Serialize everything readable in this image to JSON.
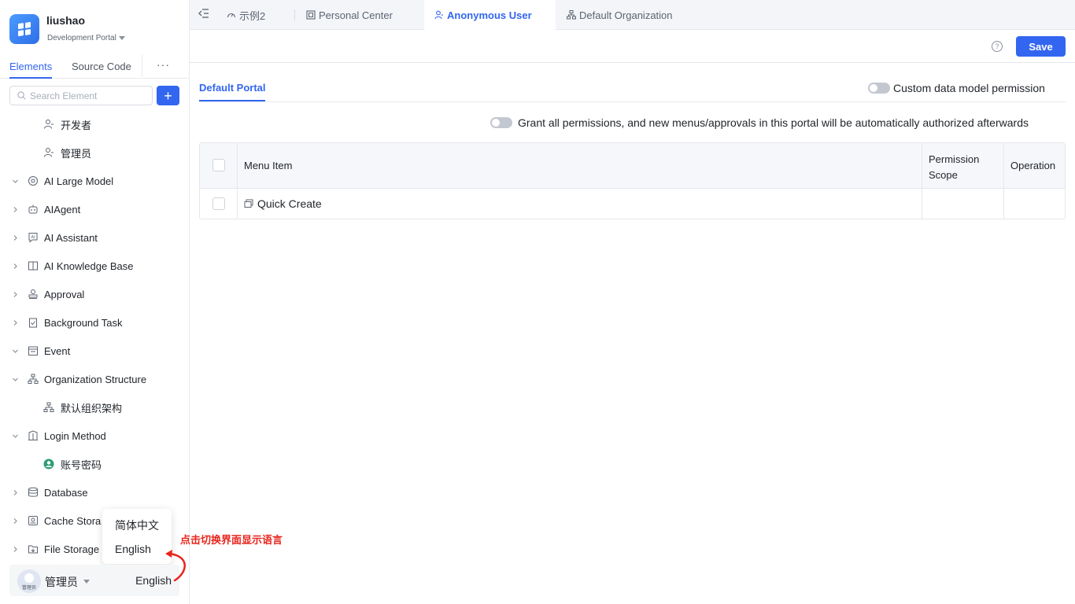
{
  "app": {
    "name": "liushao",
    "portal": "Development Portal"
  },
  "side_tabs": [
    "Elements",
    "Source Code",
    "···"
  ],
  "search": {
    "placeholder": "Search Element",
    "add_label": "+"
  },
  "tree": [
    {
      "label": "开发者",
      "icon": "role-icon",
      "expand": "none"
    },
    {
      "label": "管理员",
      "icon": "role-icon",
      "expand": "none"
    },
    {
      "label": "AI Large Model",
      "icon": "ai-model-icon",
      "expand": "open"
    },
    {
      "label": "AIAgent",
      "icon": "robot-icon",
      "expand": "closed"
    },
    {
      "label": "AI Assistant",
      "icon": "ai-assistant-icon",
      "expand": "closed"
    },
    {
      "label": "AI Knowledge Base",
      "icon": "book-icon",
      "expand": "closed"
    },
    {
      "label": "Approval",
      "icon": "stamp-icon",
      "expand": "closed"
    },
    {
      "label": "Background Task",
      "icon": "task-icon",
      "expand": "closed"
    },
    {
      "label": "Event",
      "icon": "event-icon",
      "expand": "open"
    },
    {
      "label": "Organization Structure",
      "icon": "org-icon",
      "expand": "open"
    },
    {
      "label": "默认组织架构",
      "icon": "org-icon",
      "expand": "none"
    },
    {
      "label": "Login Method",
      "icon": "login-icon",
      "expand": "open"
    },
    {
      "label": "账号密码",
      "icon": "user-circle-icon",
      "expand": "none"
    },
    {
      "label": "Database",
      "icon": "database-icon",
      "expand": "closed"
    },
    {
      "label": "Cache Stora",
      "icon": "cache-icon",
      "expand": "closed"
    },
    {
      "label": "File Storage",
      "icon": "file-storage-icon",
      "expand": "closed"
    }
  ],
  "lang_menu": {
    "options": [
      "简体中文",
      "English"
    ]
  },
  "annotation": "点击切换界面显示语言",
  "user": {
    "name": "管理员",
    "avatar_caption": "管理员",
    "language": "English"
  },
  "page_tabs": [
    {
      "label": "示例2",
      "icon": "dashboard-icon"
    },
    {
      "label": "Personal Center",
      "icon": "layout-icon"
    },
    {
      "label": "Anonymous User",
      "icon": "role-icon"
    },
    {
      "label": "Default Organization",
      "icon": "org-icon"
    }
  ],
  "toolbar": {
    "help": "?",
    "save_label": "Save"
  },
  "portal_tab": "Default Portal",
  "custom_perm_label": "Custom data model permission",
  "grant_all_label": "Grant all permissions, and new menus/approvals in this portal will be automatically authorized afterwards",
  "table": {
    "headers": [
      "Menu Item",
      "Permission Scope",
      "Operation"
    ],
    "rows": [
      {
        "menu_item": "Quick Create",
        "scope": "",
        "operation": ""
      }
    ]
  },
  "colors": {
    "accent": "#3366f0",
    "annotation": "#e8251d"
  }
}
